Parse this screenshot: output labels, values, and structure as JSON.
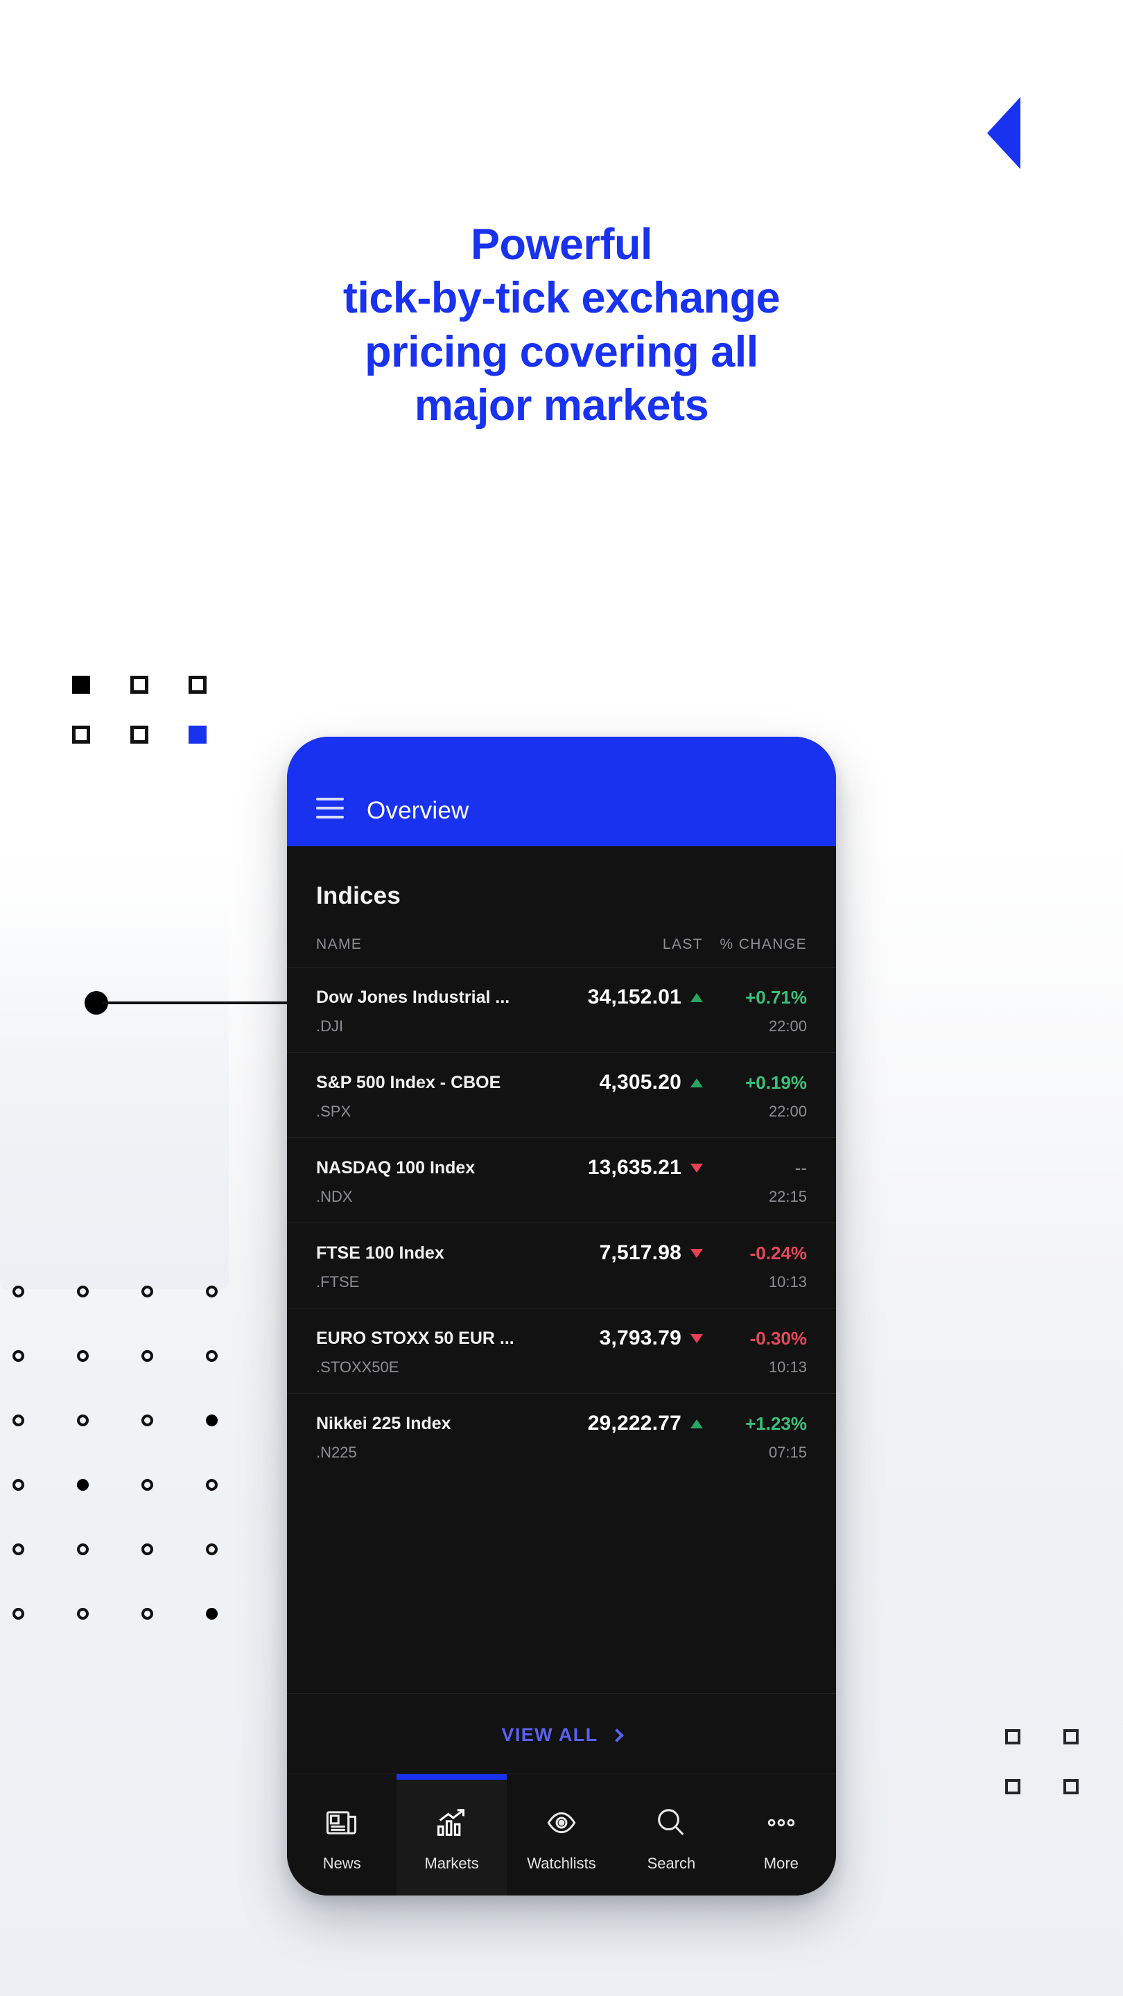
{
  "headline": {
    "lines": [
      "Powerful",
      "tick-by-tick exchange",
      "pricing covering all",
      "major markets"
    ],
    "color": "#1832f0"
  },
  "decor": {
    "triangle_icon": "play-triangle-left",
    "squares_top_left": [
      "filled-black",
      "outline",
      "outline",
      "outline",
      "outline",
      "filled-blue"
    ],
    "squares_bottom_right": [
      "outline",
      "outline",
      "outline",
      "outline"
    ],
    "dots_grid": {
      "columns": 4,
      "rows": 6,
      "filled_cells": [
        [
          3,
          4
        ],
        [
          4,
          2
        ],
        [
          6,
          4
        ]
      ]
    },
    "connector": "node-and-line"
  },
  "phone": {
    "header": {
      "menu_icon": "hamburger-icon",
      "title": "Overview",
      "background": "#1832f0"
    },
    "section_title": "Indices",
    "table": {
      "columns": [
        "NAME",
        "LAST",
        "% CHANGE"
      ],
      "rows": [
        {
          "name": "Dow Jones Industrial ...",
          "symbol": ".DJI",
          "last": "34,152.01",
          "direction": "up",
          "change": "+0.71%",
          "time": "22:00"
        },
        {
          "name": "S&P 500 Index - CBOE",
          "symbol": ".SPX",
          "last": "4,305.20",
          "direction": "up",
          "change": "+0.19%",
          "time": "22:00"
        },
        {
          "name": "NASDAQ 100 Index",
          "symbol": ".NDX",
          "last": "13,635.21",
          "direction": "down",
          "change": "--",
          "time": "22:15"
        },
        {
          "name": "FTSE 100 Index",
          "symbol": ".FTSE",
          "last": "7,517.98",
          "direction": "down",
          "change": "-0.24%",
          "time": "10:13"
        },
        {
          "name": "EURO STOXX 50 EUR ...",
          "symbol": ".STOXX50E",
          "last": "3,793.79",
          "direction": "down",
          "change": "-0.30%",
          "time": "10:13"
        },
        {
          "name": "Nikkei 225 Index",
          "symbol": ".N225",
          "last": "29,222.77",
          "direction": "up",
          "change": "+1.23%",
          "time": "07:15"
        }
      ]
    },
    "view_all": {
      "label": "VIEW ALL",
      "chevron_icon": "chevron-right-icon"
    },
    "tabs": [
      {
        "label": "News",
        "icon": "newspaper-icon",
        "active": false
      },
      {
        "label": "Markets",
        "icon": "bar-chart-icon",
        "active": true
      },
      {
        "label": "Watchlists",
        "icon": "eye-icon",
        "active": false
      },
      {
        "label": "Search",
        "icon": "magnifier-icon",
        "active": false
      },
      {
        "label": "More",
        "icon": "ellipsis-icon",
        "active": false
      }
    ],
    "colors": {
      "accent": "#1832f0",
      "up": "#3dbf7c",
      "down": "#e3485c",
      "link": "#5a62f0",
      "surface": "#121212"
    }
  }
}
